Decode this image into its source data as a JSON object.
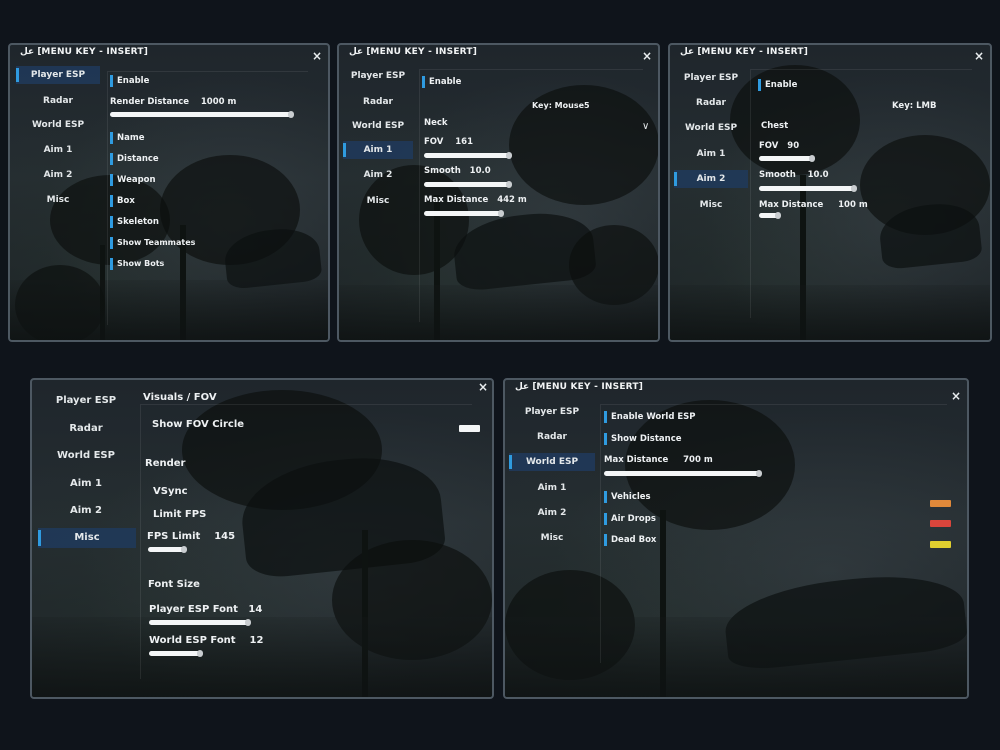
{
  "menu_title": "عل [MENU KEY - INSERT]",
  "close_glyph": "×",
  "nav": {
    "player_esp": "Player ESP",
    "radar": "Radar",
    "world_esp": "World ESP",
    "aim1": "Aim 1",
    "aim2": "Aim 2",
    "misc": "Misc"
  },
  "player_esp": {
    "enable": "Enable",
    "render_distance_label": "Render Distance",
    "render_distance_value": "1000 m",
    "render_distance_fill": 1.0,
    "options": [
      "Name",
      "Distance",
      "Weapon",
      "Box",
      "Skeleton",
      "Show Teammates",
      "Show Bots"
    ]
  },
  "aim1": {
    "enable": "Enable",
    "key": "Key: Mouse5",
    "bone": "Neck",
    "dropdown_icon": "∨",
    "fov_label": "FOV",
    "fov_value": "161",
    "smooth_label": "Smooth",
    "smooth_value": "10.0",
    "max_distance_label": "Max Distance",
    "max_distance_value": "442 m"
  },
  "aim2": {
    "enable": "Enable",
    "key": "Key: LMB",
    "bone": "Chest",
    "fov_label": "FOV",
    "fov_value": "90",
    "smooth_label": "Smooth",
    "smooth_value": "10.0",
    "max_distance_label": "Max Distance",
    "max_distance_value": "100 m"
  },
  "misc": {
    "visuals_header": "Visuals / FOV",
    "show_fov_circle": "Show FOV Circle",
    "render_header": "Render",
    "vsync": "VSync",
    "limit_fps": "Limit FPS",
    "fps_limit_label": "FPS Limit",
    "fps_limit_value": "145",
    "font_size_header": "Font Size",
    "player_esp_font_label": "Player ESP Font",
    "player_esp_font_value": "14",
    "world_esp_font_label": "World ESP Font",
    "world_esp_font_value": "12"
  },
  "world_esp": {
    "enable_world_esp": "Enable World ESP",
    "show_distance": "Show Distance",
    "max_distance_label": "Max Distance",
    "max_distance_value": "700 m",
    "vehicles": "Vehicles",
    "air_drops": "Air Drops",
    "dead_box": "Dead Box",
    "colors": {
      "vehicles": "#e0893a",
      "air_drops": "#d9453c",
      "dead_box": "#e0cf2f"
    }
  },
  "accent": "#2f9be0"
}
